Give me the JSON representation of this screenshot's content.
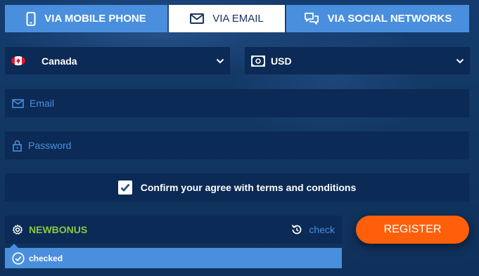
{
  "tabs": [
    {
      "label": "VIA MOBILE PHONE",
      "icon": "phone-icon",
      "active": false
    },
    {
      "label": "VIA EMAIL",
      "icon": "envelope-icon",
      "active": true
    },
    {
      "label": "VIA SOCIAL NETWORKS",
      "icon": "chat-bubbles-icon",
      "active": false
    }
  ],
  "country": {
    "value": "Canada",
    "icon": "canada-flag-icon"
  },
  "currency": {
    "value": "USD",
    "icon": "banknote-icon"
  },
  "email": {
    "placeholder": "Email",
    "value": ""
  },
  "password": {
    "placeholder": "Password",
    "value": ""
  },
  "agree": {
    "label": "Confirm your agree with terms and conditions",
    "checked": true
  },
  "promo": {
    "value": "NEWBONUS",
    "check_label": "check"
  },
  "promo_status": {
    "text": "checked"
  },
  "register": {
    "label": "REGISTER"
  },
  "colors": {
    "background": "#133a68",
    "field": "#0b2a55",
    "accent_blue": "#4a8fde",
    "promo_green": "#8ec63f",
    "register_orange": "#ff5f0b"
  }
}
